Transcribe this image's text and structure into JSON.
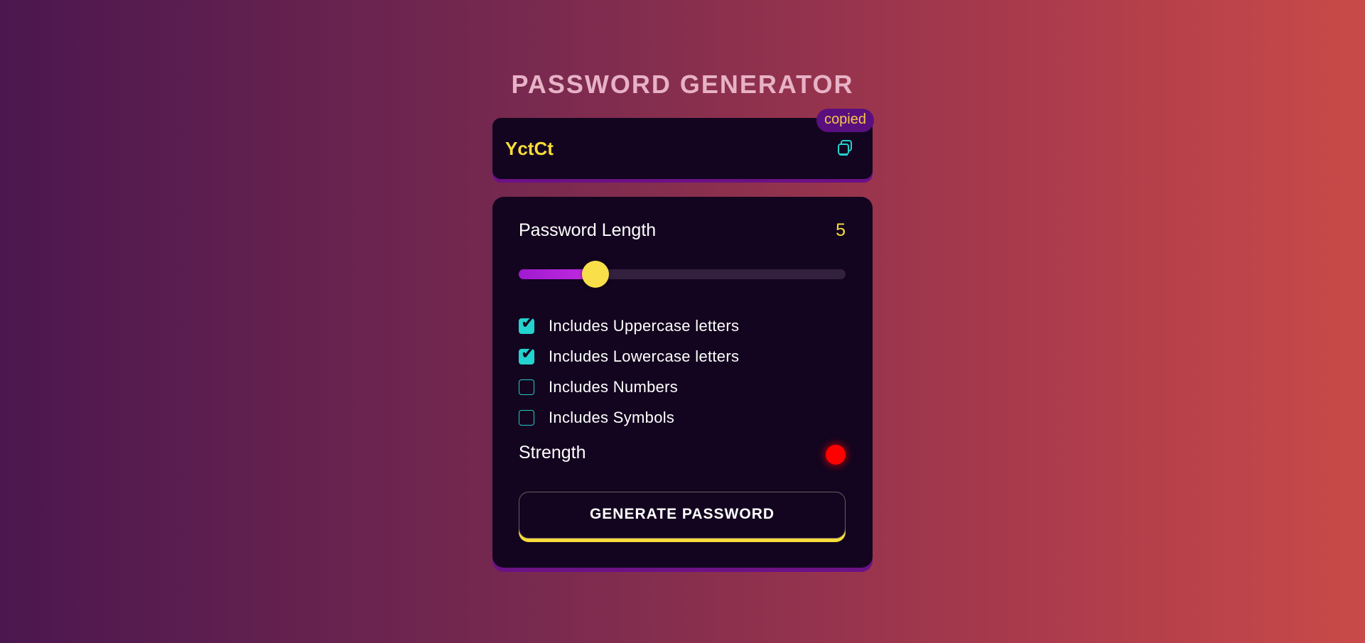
{
  "header": {
    "title": "PASSWORD GENERATOR"
  },
  "output": {
    "password": "YctCt",
    "copied_label": "copied",
    "copy_icon": "copy-icon"
  },
  "settings": {
    "length_label": "Password Length",
    "length_value": "5",
    "slider_fraction": 0.235,
    "options": [
      {
        "label": "Includes Uppercase letters",
        "checked": true
      },
      {
        "label": "Includes Lowercase letters",
        "checked": true
      },
      {
        "label": "Includes Numbers",
        "checked": false
      },
      {
        "label": "Includes Symbols",
        "checked": false
      }
    ],
    "strength_label": "Strength",
    "strength_color": "#ff0000",
    "generate_label": "GENERATE PASSWORD"
  },
  "colors": {
    "accent_yellow": "#f6dd3a",
    "accent_teal": "#22d3d0",
    "card_bg": "#13051f",
    "purple_shadow": "#6d1186"
  }
}
